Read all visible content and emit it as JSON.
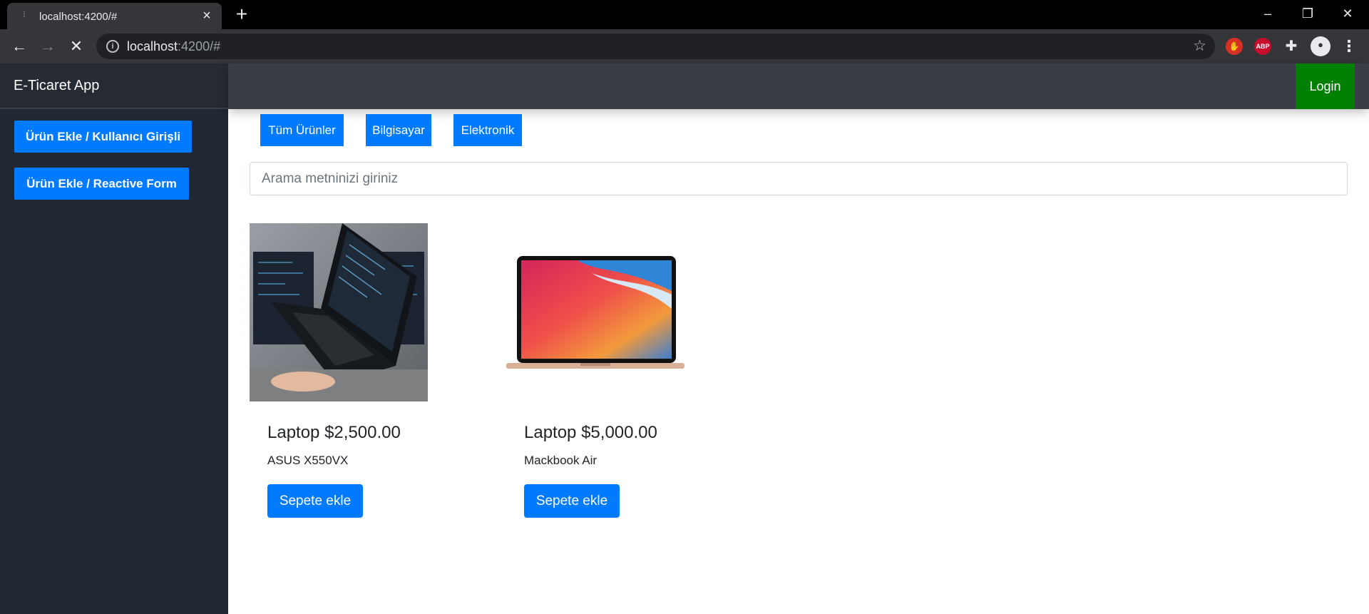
{
  "browser": {
    "tab_title": "localhost:4200/#",
    "url_host": "localhost",
    "url_rest": ":4200/#"
  },
  "app": {
    "brand": "E-Ticaret App",
    "login_label": "Login",
    "sidebar_buttons": [
      "Ürün Ekle / Kullanıcı Girişli",
      "Ürün Ekle / Reactive Form"
    ],
    "categories": [
      "Tüm Ürünler",
      "Bilgisayar",
      "Elektronik"
    ],
    "search_placeholder": "Arama metninizi giriniz",
    "products": [
      {
        "title": "Laptop $2,500.00",
        "description": "ASUS X550VX",
        "button": "Sepete ekle"
      },
      {
        "title": "Laptop $5,000.00",
        "description": "Mackbook Air",
        "button": "Sepete ekle"
      }
    ]
  },
  "colors": {
    "primary": "#007bff",
    "login": "#008000",
    "sidebar": "#222831",
    "topnav": "#393e46"
  }
}
